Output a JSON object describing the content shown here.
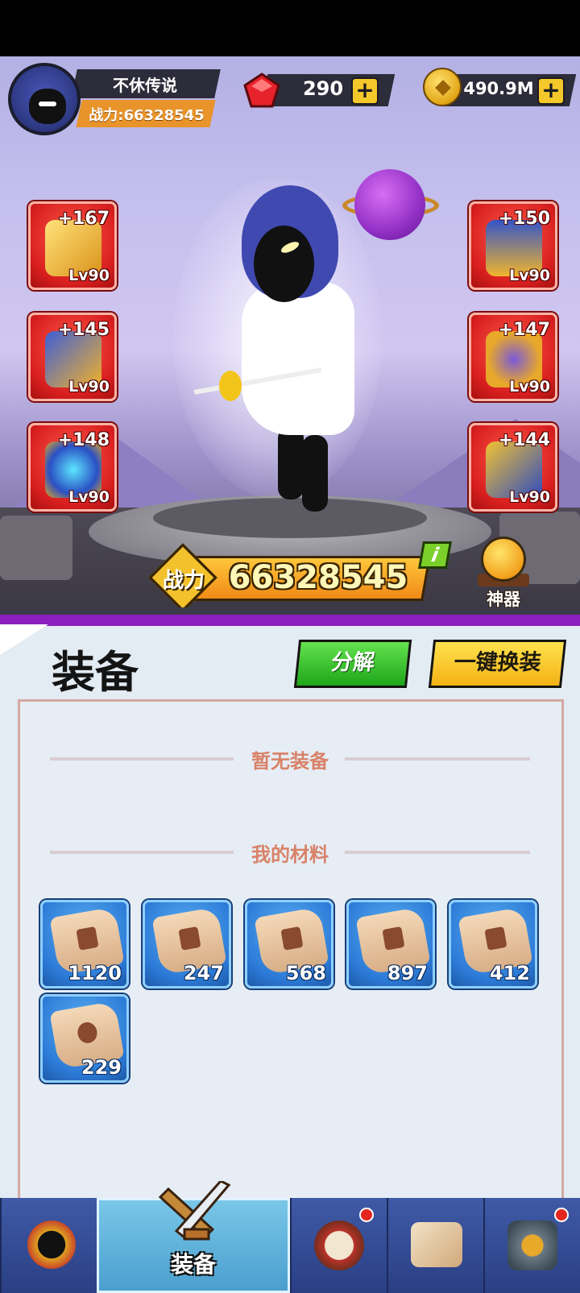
{
  "player": {
    "name": "不休传说",
    "power_label": "战力:66328545"
  },
  "currency": {
    "gems": "290",
    "coins": "490.9M",
    "plus": "+"
  },
  "equipment_slots": [
    {
      "bonus": "+167",
      "level": "Lv90",
      "icon": "golden-sword-icon"
    },
    {
      "bonus": "+145",
      "level": "Lv90",
      "icon": "golden-boots-icon"
    },
    {
      "bonus": "+148",
      "level": "Lv90",
      "icon": "gem-ring-icon"
    },
    {
      "bonus": "+150",
      "level": "Lv90",
      "icon": "blue-helmet-icon"
    },
    {
      "bonus": "+147",
      "level": "Lv90",
      "icon": "golden-armor-icon"
    },
    {
      "bonus": "+144",
      "level": "Lv90",
      "icon": "golden-bracer-icon"
    }
  ],
  "combat_power": {
    "label": "战力",
    "value": "66328545",
    "info": "i"
  },
  "artifact": {
    "label": "神器"
  },
  "panel": {
    "title": "装备",
    "decompose_button": "分解",
    "auto_equip_button": "一键换装",
    "no_equipment": "暂无装备",
    "my_materials": "我的材料"
  },
  "materials": [
    {
      "count": "1120",
      "icon": "sword-scroll-icon"
    },
    {
      "count": "247",
      "icon": "armor-scroll-icon"
    },
    {
      "count": "568",
      "icon": "helmet-scroll-icon"
    },
    {
      "count": "897",
      "icon": "boot-scroll-icon"
    },
    {
      "count": "412",
      "icon": "bracer-scroll-icon"
    },
    {
      "count": "229",
      "icon": "ring-scroll-icon"
    }
  ],
  "nav": {
    "active_label": "装备",
    "tabs": [
      "hero-icon",
      "equipment-icon",
      "drum-icon",
      "scroll-map-icon",
      "shop-icon"
    ]
  },
  "colors": {
    "equip_slot_red": "#d81f1f",
    "material_blue": "#2c7ad7",
    "decompose_green": "#1ea61a",
    "auto_equip_yellow": "#f4b215",
    "section_label_orange": "#d88268"
  }
}
